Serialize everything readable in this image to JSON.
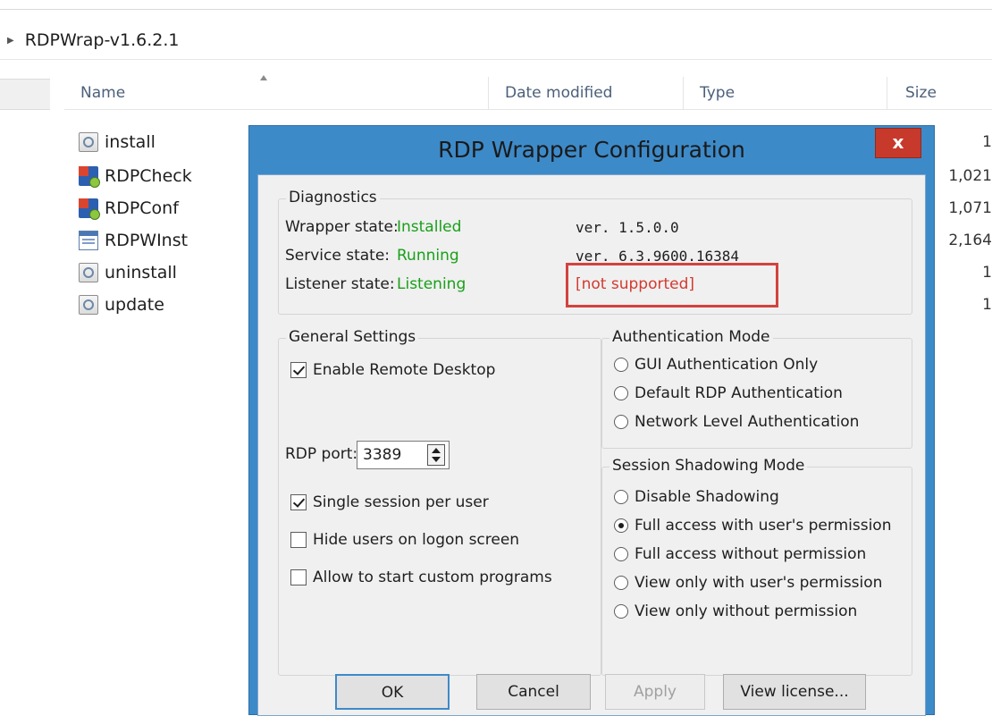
{
  "explorer": {
    "breadcrumb": "RDPWrap-v1.6.2.1",
    "columns": {
      "name": "Name",
      "date_modified": "Date modified",
      "type": "Type",
      "size": "Size"
    },
    "files": [
      {
        "name": "install",
        "icon": "script-icon"
      },
      {
        "name": "RDPCheck",
        "icon": "app-icon"
      },
      {
        "name": "RDPConf",
        "icon": "app-icon"
      },
      {
        "name": "RDPWInst",
        "icon": "window-app-icon"
      },
      {
        "name": "uninstall",
        "icon": "script-icon"
      },
      {
        "name": "update",
        "icon": "script-icon"
      }
    ],
    "sizes_visible": [
      "1",
      "1,021",
      "1,071",
      "2,164",
      "1",
      "1"
    ]
  },
  "dialog": {
    "title": "RDP Wrapper Configuration",
    "close_label": "x",
    "diagnostics": {
      "legend": "Diagnostics",
      "wrapper_label": "Wrapper state:",
      "wrapper_value": "Installed",
      "wrapper_version": "ver. 1.5.0.0",
      "service_label": "Service state:",
      "service_value": "Running",
      "service_version": "ver. 6.3.9600.16384",
      "listener_label": "Listener state:",
      "listener_value": "Listening",
      "listener_support": "[not supported]"
    },
    "general": {
      "legend": "General Settings",
      "enable_rdp": "Enable Remote Desktop",
      "enable_rdp_checked": true,
      "port_label": "RDP port:",
      "port_value": "3389",
      "single_session": "Single session per user",
      "single_session_checked": true,
      "hide_users": "Hide users on logon screen",
      "hide_users_checked": false,
      "custom_programs": "Allow to start custom programs",
      "custom_programs_checked": false
    },
    "auth": {
      "legend": "Authentication Mode",
      "options": [
        "GUI Authentication Only",
        "Default RDP Authentication",
        "Network Level Authentication"
      ],
      "selected": null
    },
    "shadow": {
      "legend": "Session Shadowing Mode",
      "options": [
        "Disable Shadowing",
        "Full access with user's permission",
        "Full access without permission",
        "View only with user's permission",
        "View only without permission"
      ],
      "selected": "Full access with user's permission"
    },
    "buttons": {
      "ok": "OK",
      "cancel": "Cancel",
      "apply": "Apply",
      "view_license": "View license..."
    }
  },
  "colors": {
    "title_bar": "#3d8ac9",
    "close_button": "#c7392b",
    "status_green": "#19a019",
    "warning_red": "#d33a2f"
  }
}
